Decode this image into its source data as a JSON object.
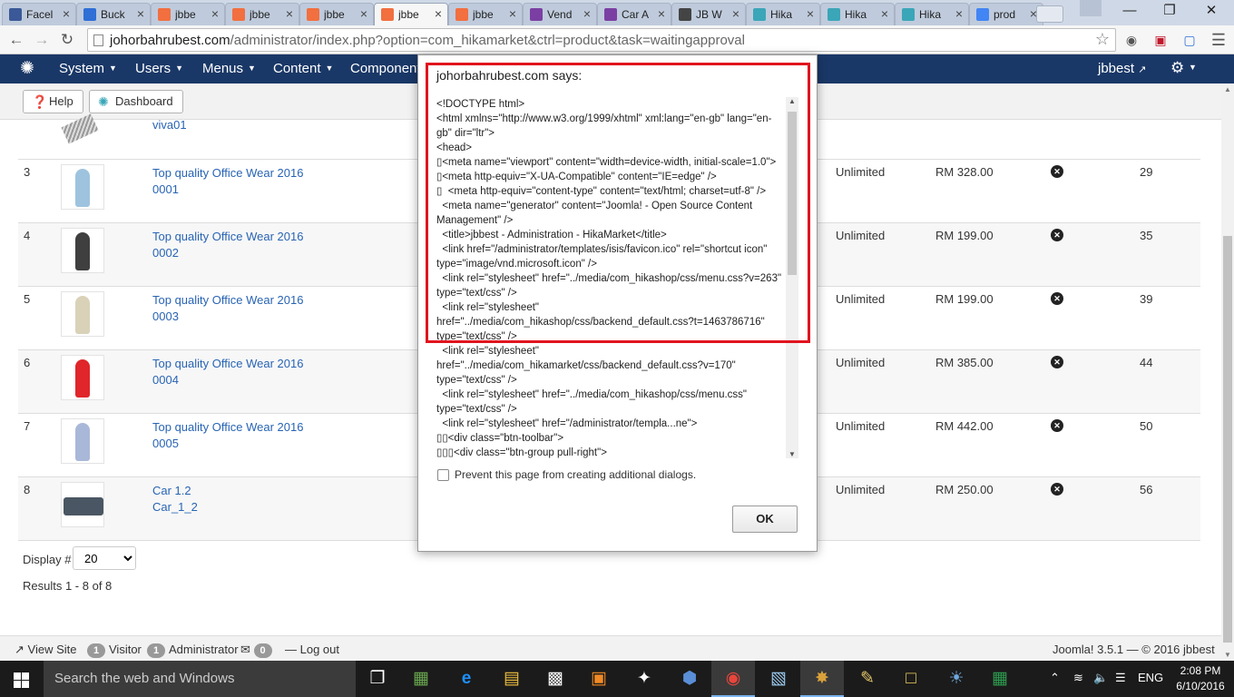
{
  "browser": {
    "tabs": [
      {
        "label": "Facel",
        "color": "#3b5998",
        "icon": "facebook-icon"
      },
      {
        "label": "Buck",
        "color": "#2f6fd6",
        "icon": "doc-icon"
      },
      {
        "label": "jbbe",
        "color": "#f26f3f",
        "icon": "joomla-icon"
      },
      {
        "label": "jbbe",
        "color": "#f26f3f",
        "icon": "joomla-icon"
      },
      {
        "label": "jbbe",
        "color": "#f26f3f",
        "icon": "joomla-icon"
      },
      {
        "label": "jbbe",
        "color": "#f26f3f",
        "icon": "joomla-icon"
      },
      {
        "label": "jbbe",
        "color": "#f26f3f",
        "icon": "joomla-icon"
      },
      {
        "label": "Vend",
        "color": "#7b3fa3",
        "icon": "b-icon"
      },
      {
        "label": "Car A",
        "color": "#7b3fa3",
        "icon": "b-icon"
      },
      {
        "label": "JB W",
        "color": "#444444",
        "icon": "clock-icon"
      },
      {
        "label": "Hika",
        "color": "#3aa6b8",
        "icon": "hika-icon"
      },
      {
        "label": "Hika",
        "color": "#3aa6b8",
        "icon": "hika-icon"
      },
      {
        "label": "Hika",
        "color": "#3aa6b8",
        "icon": "hika-icon"
      },
      {
        "label": "prod",
        "color": "#4285f4",
        "icon": "google-icon"
      }
    ],
    "active_tab_index": 5,
    "url_host": "johorbahrubest.com",
    "url_path": "/administrator/index.php?option=com_hikamarket&ctrl=product&task=waitingapproval"
  },
  "joomla": {
    "menu": [
      {
        "label": "System"
      },
      {
        "label": "Users"
      },
      {
        "label": "Menus"
      },
      {
        "label": "Content"
      },
      {
        "label": "Component"
      }
    ],
    "user": "jbbest",
    "toolbar": {
      "help_label": "Help",
      "dashboard_label": "Dashboard"
    }
  },
  "products": {
    "partial_row": {
      "name": "viva01"
    },
    "rows": [
      {
        "num": "3",
        "name1": "Top quality Office Wear 2016",
        "name2": "0001",
        "quantity": "Unlimited",
        "price": "RM 328.00",
        "id": "29",
        "color": "#9ec3de"
      },
      {
        "num": "4",
        "name1": "Top quality Office Wear 2016",
        "name2": "0002",
        "quantity": "Unlimited",
        "price": "RM 199.00",
        "id": "35",
        "color": "#3f3f3f"
      },
      {
        "num": "5",
        "name1": "Top quality Office Wear 2016",
        "name2": "0003",
        "quantity": "Unlimited",
        "price": "RM 199.00",
        "id": "39",
        "color": "#d9d2b8"
      },
      {
        "num": "6",
        "name1": "Top quality Office Wear 2016",
        "name2": "0004",
        "quantity": "Unlimited",
        "price": "RM 385.00",
        "id": "44",
        "color": "#e0262a"
      },
      {
        "num": "7",
        "name1": "Top quality Office Wear 2016",
        "name2": "0005",
        "quantity": "Unlimited",
        "price": "RM 442.00",
        "id": "50",
        "color": "#a9b8d8"
      },
      {
        "num": "8",
        "name1": "Car 1.2",
        "name2": "Car_1_2",
        "quantity": "Unlimited",
        "price": "RM 250.00",
        "id": "56",
        "color": "#4a5663"
      }
    ],
    "display_label": "Display #",
    "display_value": "20",
    "results": "Results 1 - 8 of 8"
  },
  "footer": {
    "view_site": "View Site",
    "visitors_count": "1",
    "visitors_label": "Visitor",
    "admins_count": "1",
    "admins_label": "Administrator",
    "messages_count": "0",
    "logout": "Log out",
    "version": "Joomla! 3.5.1 — © 2016 jbbest"
  },
  "dialog": {
    "title": "johorbahrubest.com says:",
    "content": "<!DOCTYPE html>\n<html xmlns=\"http://www.w3.org/1999/xhtml\" xml:lang=\"en-gb\" lang=\"en-gb\" dir=\"ltr\">\n<head>\n▯<meta name=\"viewport\" content=\"width=device-width, initial-scale=1.0\">\n▯<meta http-equiv=\"X-UA-Compatible\" content=\"IE=edge\" />\n▯  <meta http-equiv=\"content-type\" content=\"text/html; charset=utf-8\" />\n  <meta name=\"generator\" content=\"Joomla! - Open Source Content Management\" />\n  <title>jbbest - Administration - HikaMarket</title>\n  <link href=\"/administrator/templates/isis/favicon.ico\" rel=\"shortcut icon\" type=\"image/vnd.microsoft.icon\" />\n  <link rel=\"stylesheet\" href=\"../media/com_hikashop/css/menu.css?v=263\" type=\"text/css\" />\n  <link rel=\"stylesheet\" href=\"../media/com_hikashop/css/backend_default.css?t=1463786716\" type=\"text/css\" />\n  <link rel=\"stylesheet\" href=\"../media/com_hikamarket/css/backend_default.css?v=170\" type=\"text/css\" />\n  <link rel=\"stylesheet\" href=\"../media/com_hikashop/css/menu.css\" type=\"text/css\" />\n  <link rel=\"stylesheet\" href=\"/administrator/templa...ne\">\n▯▯<div class=\"btn-toolbar\">\n▯▯▯<div class=\"btn-group pull-right\">",
    "checkbox_label": "Prevent this page from creating additional dialogs.",
    "ok_label": "OK"
  },
  "taskbar": {
    "search_placeholder": "Search the web and Windows",
    "language": "ENG",
    "time": "2:08 PM",
    "date": "6/10/2016"
  }
}
